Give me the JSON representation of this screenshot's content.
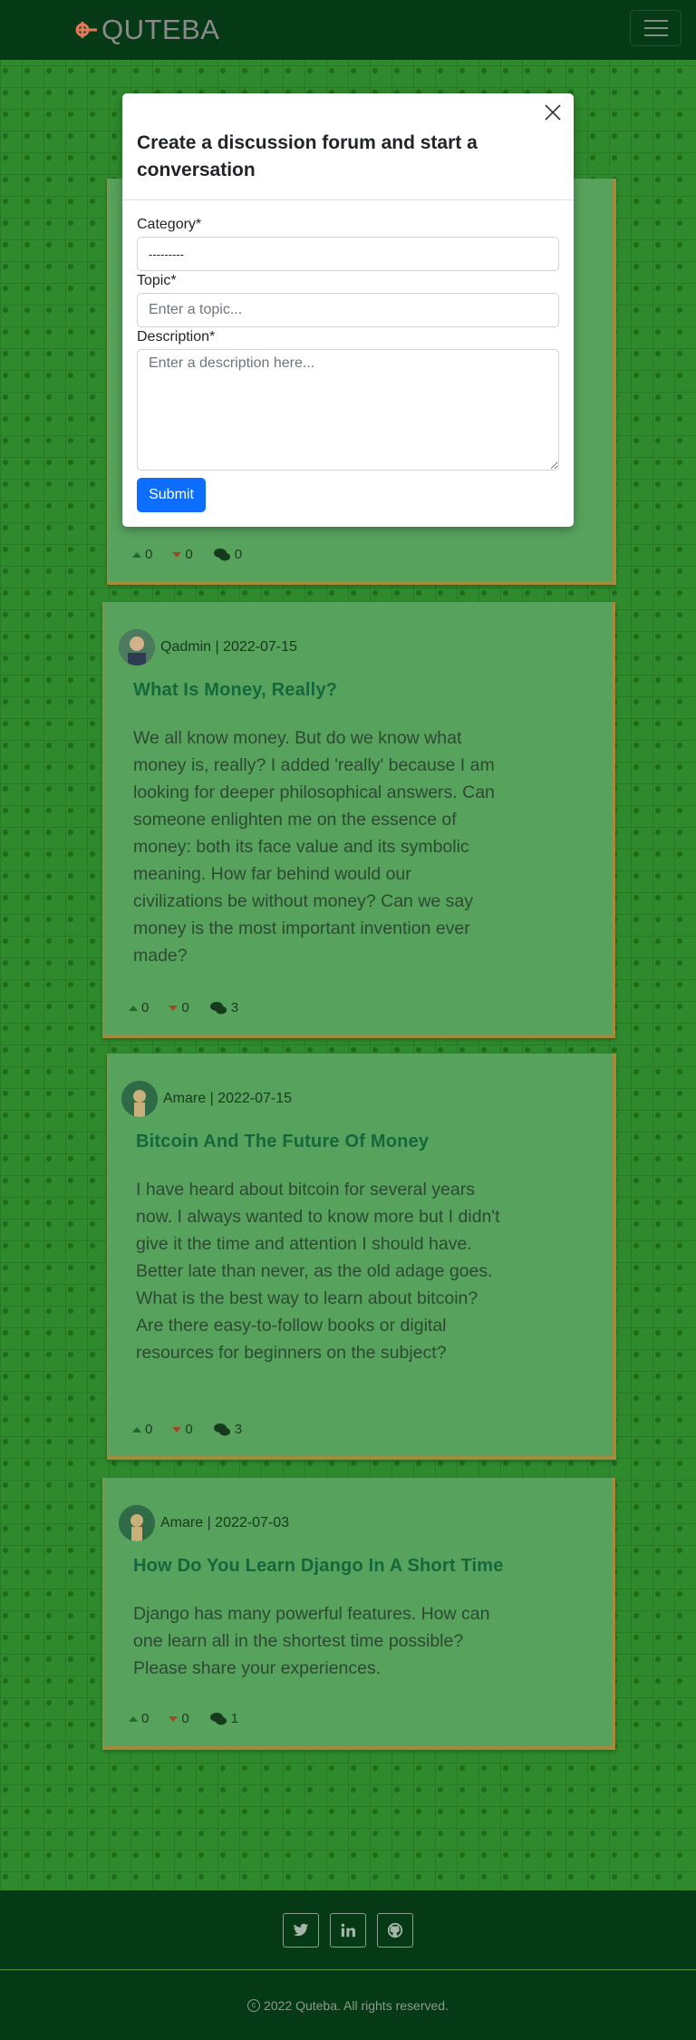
{
  "navbar": {
    "brand_name": "QUTEBA",
    "toggle_icon": "hamburger-menu-icon"
  },
  "posts": [
    {
      "author": "Qadmin",
      "date": "2022-07-15",
      "meta": "Qadmin | 2022-07-15",
      "title": "What Is Money, Really?",
      "body": "We all know money. But do we know what money is, really? I added 'really' because I am looking for deeper philosophical answers. Can someone enlighten me on the essence of money: both its face value and its symbolic meaning. How far behind would our civilizations be without money? Can we say money is the most important invention ever made?",
      "upvotes": "0",
      "downvotes": "0",
      "comments": "3"
    },
    {
      "author": "Amare",
      "date": "2022-07-15",
      "meta": "Amare | 2022-07-15",
      "title": "Bitcoin And The Future Of Money",
      "body": "I have heard about bitcoin for several years now. I always wanted to know more but I didn't give it the time and attention I should have. Better late than never, as the old adage goes. What is the best way to learn about bitcoin? Are there easy-to-follow books or digital resources for beginners on the subject?",
      "upvotes": "0",
      "downvotes": "0",
      "comments": "3"
    },
    {
      "author": "Amare",
      "date": "2022-07-03",
      "meta": "Amare | 2022-07-03",
      "title": "How Do You Learn Django In A Short Time",
      "body": "Django has many powerful features. How can one learn all in the shortest time possible? Please share your experiences.",
      "upvotes": "0",
      "downvotes": "0",
      "comments": "1"
    }
  ],
  "hidden_post_stats": {
    "upvotes": "0",
    "downvotes": "0",
    "comments": "0"
  },
  "modal": {
    "title": "Create a discussion forum and start a conversation",
    "category_label": "Category*",
    "category_value": "---------",
    "topic_label": "Topic*",
    "topic_placeholder": "Enter a topic...",
    "description_label": "Description*",
    "description_placeholder": "Enter a description here...",
    "submit_label": "Submit"
  },
  "footer": {
    "social": [
      "twitter-icon",
      "linkedin-icon",
      "github-icon"
    ],
    "copyright": "2022 Quteba. All rights reserved."
  },
  "colors": {
    "navbar_bg": "#063a17",
    "page_bg": "#2e8a2c",
    "card_bg": "#57a25c",
    "title_color": "#14683b",
    "submit_bg": "#0d6efd"
  }
}
